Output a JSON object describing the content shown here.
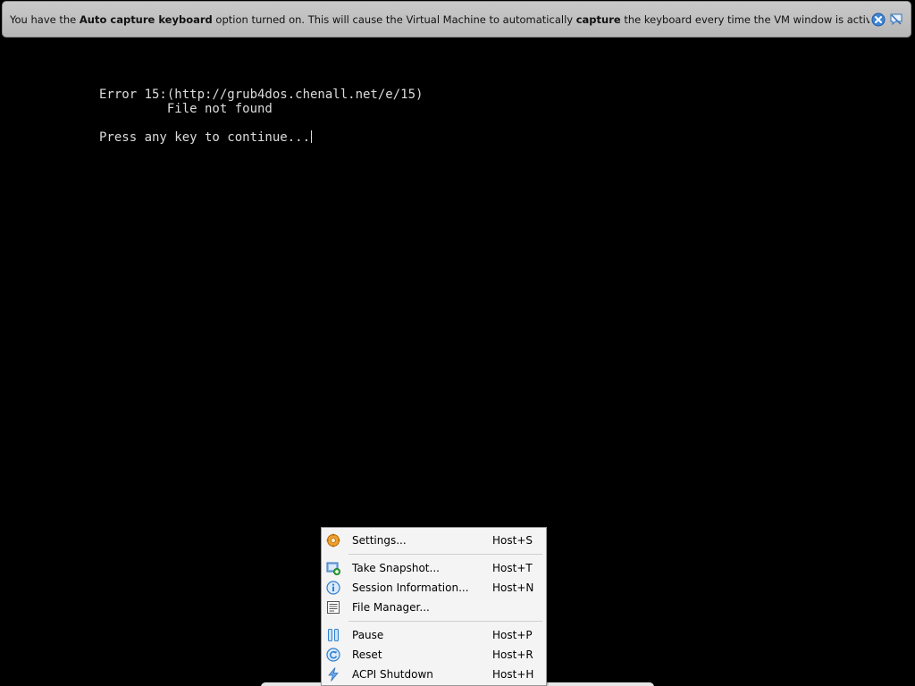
{
  "banner": {
    "text_1": "You have the ",
    "bold_1": "Auto capture keyboard",
    "text_2": " option turned on. This will cause the Virtual Machine to automatically ",
    "bold_2": "capture",
    "text_3": " the keyboard every time the VM window is activated and make it unavailable to",
    "close_icon": "close-icon",
    "mute_icon": "speech-bubble-mute-icon"
  },
  "console": {
    "line1": "Error 15:(http://grub4dos.chenall.net/e/15)",
    "line2": "         File not found",
    "line3": "",
    "line4": "Press any key to continue..."
  },
  "menu": {
    "items": [
      {
        "label": "Settings...",
        "shortcut": "Host+S",
        "icon": "settings-gear-icon"
      },
      {
        "label": "Take Snapshot...",
        "shortcut": "Host+T",
        "icon": "snapshot-icon"
      },
      {
        "label": "Session Information...",
        "shortcut": "Host+N",
        "icon": "info-icon"
      },
      {
        "label": "File Manager...",
        "shortcut": "",
        "icon": "file-manager-icon"
      },
      {
        "label": "Pause",
        "shortcut": "Host+P",
        "icon": "pause-icon"
      },
      {
        "label": "Reset",
        "shortcut": "Host+R",
        "icon": "reset-icon"
      },
      {
        "label": "ACPI Shutdown",
        "shortcut": "Host+H",
        "icon": "power-bolt-icon"
      }
    ]
  },
  "colors": {
    "background": "#000000",
    "banner_bg": "#c0c0c0",
    "console_text": "#dcdcdc",
    "menu_bg": "#f4f4f4",
    "icon_blue": "#2f7fd0"
  }
}
